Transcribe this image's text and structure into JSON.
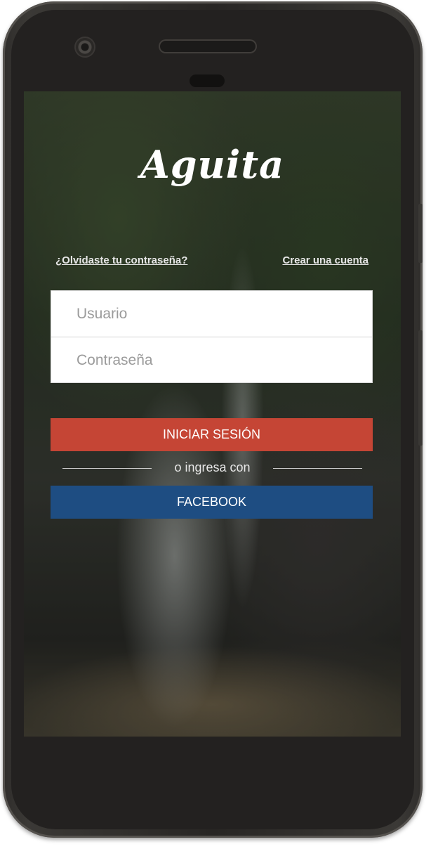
{
  "app": {
    "logo_text": "Aguita"
  },
  "links": {
    "forgot_password": "¿Olvidaste tu contraseña?",
    "create_account": "Crear una cuenta"
  },
  "form": {
    "username_placeholder": "Usuario",
    "password_placeholder": "Contraseña"
  },
  "buttons": {
    "login_label": "INICIAR SESIÓN",
    "login_color": "#c54535",
    "facebook_label": "FACEBOOK",
    "facebook_color": "#1e4d82"
  },
  "separator": {
    "text": "o ingresa con"
  },
  "icons": {
    "camera": "front-camera-icon",
    "speaker": "earpiece-speaker-icon"
  }
}
